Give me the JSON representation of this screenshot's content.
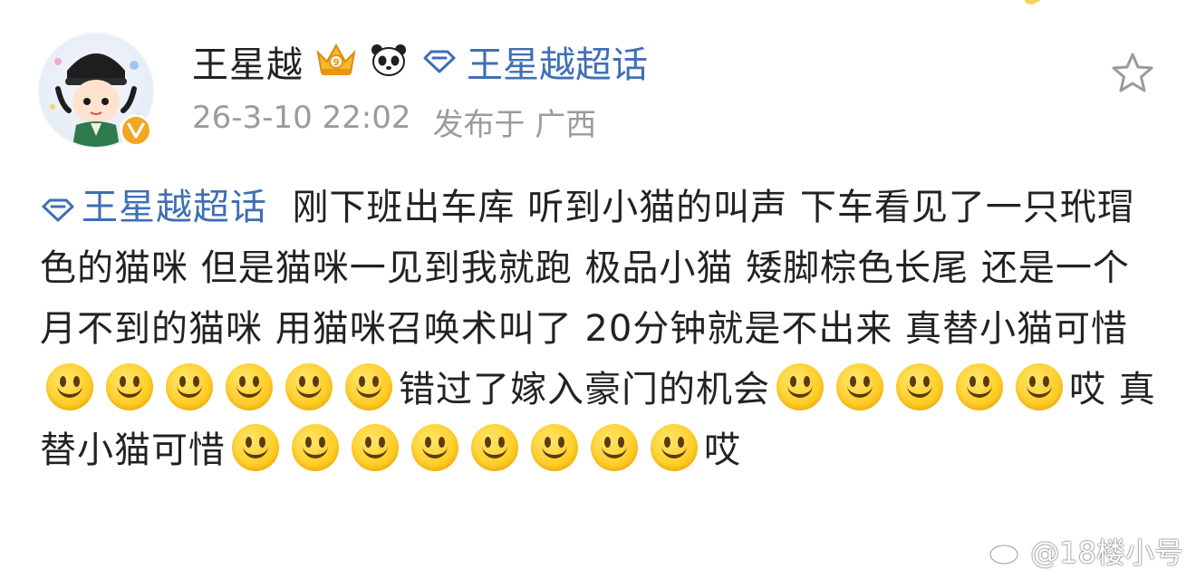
{
  "post": {
    "author": {
      "name": "王星越",
      "verified": true,
      "badges": [
        "crown-badge-icon",
        "panda-icon"
      ]
    },
    "topic_link": "王星越超话",
    "date": "26-3-10 22:02",
    "location": "发布于 广西",
    "content": {
      "topic": "王星越超话",
      "segments": [
        "刚下班出车库 听到小猫的叫声 下车看见了一只玳瑁色的猫咪 但是猫咪一见到我就跑 极品小猫 矮脚棕色长尾 还是一个月不到的猫咪 用猫咪召唤术叫了 20分钟就是不出来 真替小猫可惜",
        "错过了嫁入豪门的机会",
        "哎 真替小猫可惜",
        "哎"
      ],
      "emoji_name": "smile-emoji",
      "emoji_groups": [
        6,
        5,
        8
      ]
    }
  },
  "watermark": {
    "text": "@18楼小号"
  },
  "colors": {
    "link": "#3f6fb4",
    "meta": "#9b9b9b",
    "text": "#222222",
    "verify": "#f2a623"
  }
}
